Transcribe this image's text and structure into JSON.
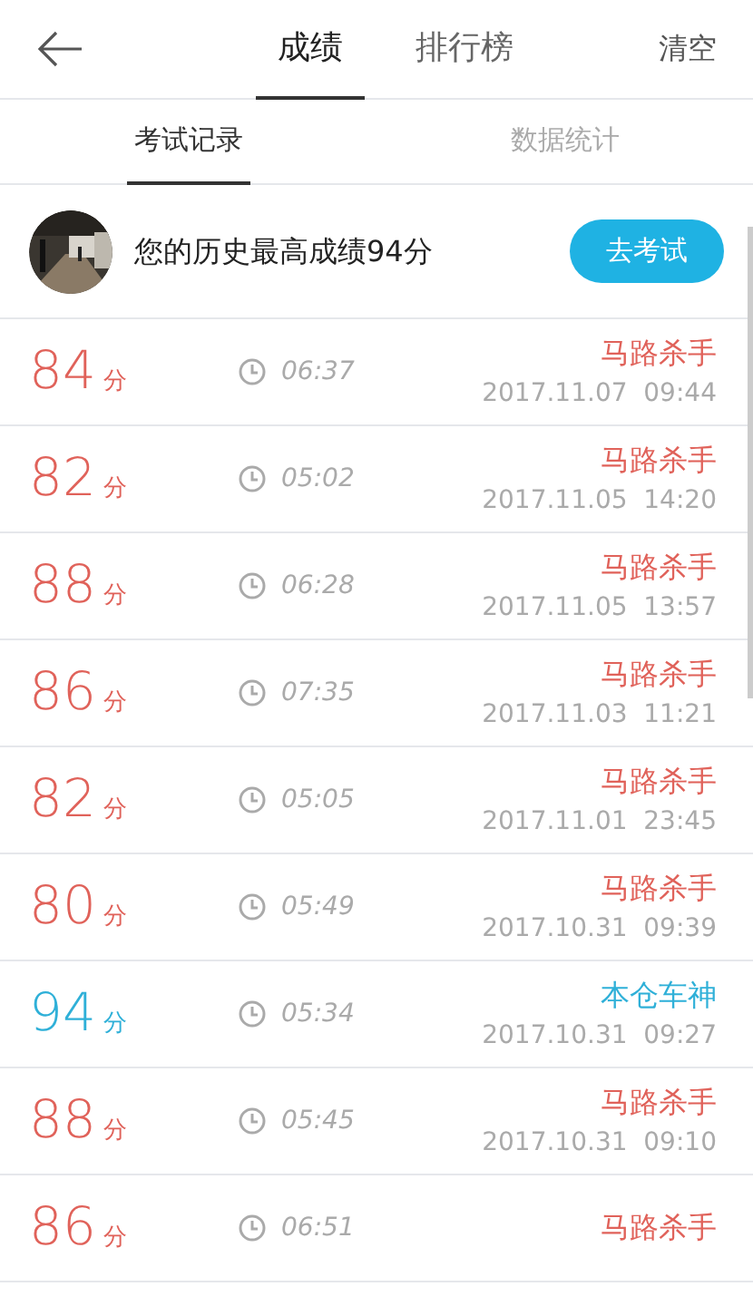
{
  "header": {
    "tabs": [
      {
        "label": "成绩",
        "selected": true
      },
      {
        "label": "排行榜",
        "selected": false
      }
    ],
    "action": "清空"
  },
  "subtabs": [
    {
      "label": "考试记录",
      "selected": true
    },
    {
      "label": "数据统计",
      "selected": false
    }
  ],
  "banner": {
    "text": "您的历史最高成绩94分",
    "button": "去考试"
  },
  "records": [
    {
      "score": "84",
      "unit": "分",
      "duration": "06:37",
      "title": "马路杀手",
      "date": "2017.11.07  09:44",
      "color": "#e0625a"
    },
    {
      "score": "82",
      "unit": "分",
      "duration": "05:02",
      "title": "马路杀手",
      "date": "2017.11.05  14:20",
      "color": "#e0625a"
    },
    {
      "score": "88",
      "unit": "分",
      "duration": "06:28",
      "title": "马路杀手",
      "date": "2017.11.05  13:57",
      "color": "#e0625a"
    },
    {
      "score": "86",
      "unit": "分",
      "duration": "07:35",
      "title": "马路杀手",
      "date": "2017.11.03  11:21",
      "color": "#e0625a"
    },
    {
      "score": "82",
      "unit": "分",
      "duration": "05:05",
      "title": "马路杀手",
      "date": "2017.11.01  23:45",
      "color": "#e0625a"
    },
    {
      "score": "80",
      "unit": "分",
      "duration": "05:49",
      "title": "马路杀手",
      "date": "2017.10.31  09:39",
      "color": "#e0625a"
    },
    {
      "score": "94",
      "unit": "分",
      "duration": "05:34",
      "title": "本仓车神",
      "date": "2017.10.31  09:27",
      "color": "#2fb0d8"
    },
    {
      "score": "88",
      "unit": "分",
      "duration": "05:45",
      "title": "马路杀手",
      "date": "2017.10.31  09:10",
      "color": "#e0625a"
    },
    {
      "score": "86",
      "unit": "分",
      "duration": "06:51",
      "title": "马路杀手",
      "color": "#e0625a"
    }
  ]
}
